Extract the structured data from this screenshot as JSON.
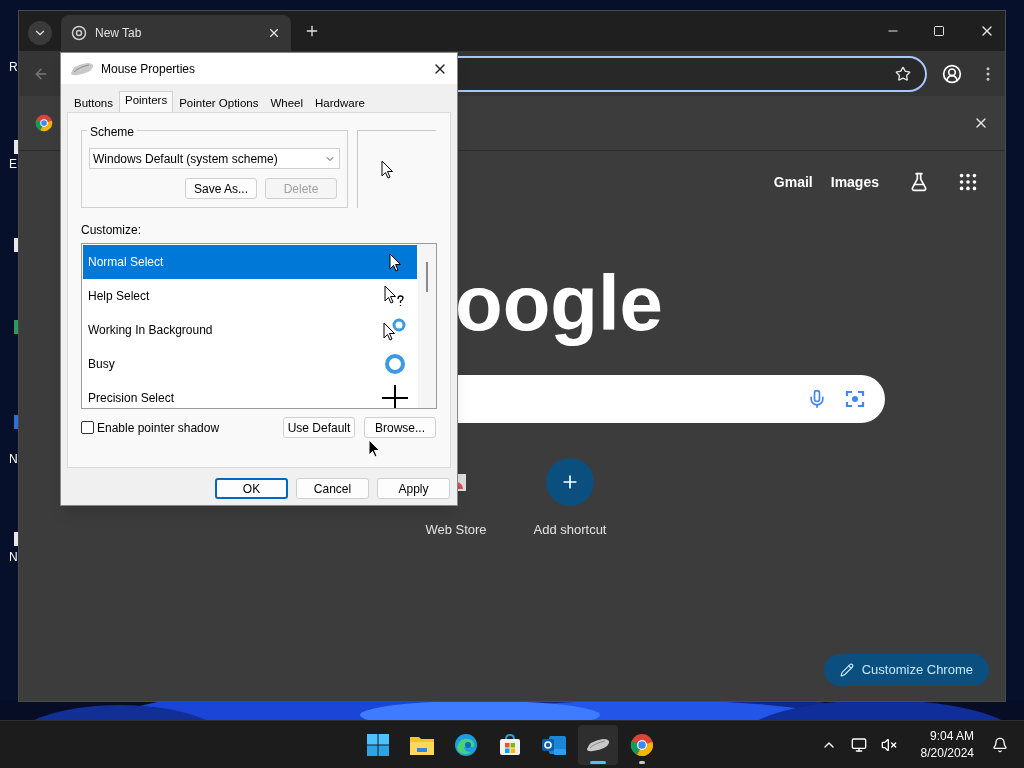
{
  "desktop": {
    "icon_labels": [
      "R",
      "E",
      "N",
      "N"
    ]
  },
  "browser": {
    "tab": {
      "title": "New Tab",
      "selected": true
    },
    "top_links": [
      "Gmail",
      "Images"
    ],
    "logo": "oogle",
    "shortcuts": [
      {
        "label": "Web Store",
        "kind": "store"
      },
      {
        "label": "Add shortcut",
        "kind": "add"
      }
    ],
    "customize_button": "Customize Chrome"
  },
  "dialog": {
    "title": "Mouse Properties",
    "tabs": [
      {
        "label": "Buttons",
        "selected": false
      },
      {
        "label": "Pointers",
        "selected": true
      },
      {
        "label": "Pointer Options",
        "selected": false
      },
      {
        "label": "Wheel",
        "selected": false
      },
      {
        "label": "Hardware",
        "selected": false
      }
    ],
    "scheme": {
      "label": "Scheme",
      "value": "Windows Default (system scheme)",
      "buttons": [
        {
          "label": "Save As...",
          "disabled": false
        },
        {
          "label": "Delete",
          "disabled": true
        }
      ]
    },
    "customize_label": "Customize:",
    "cursors": [
      {
        "name": "Normal Select",
        "kind": "arrow",
        "selected": true
      },
      {
        "name": "Help Select",
        "kind": "help",
        "selected": false
      },
      {
        "name": "Working In Background",
        "kind": "working",
        "selected": false
      },
      {
        "name": "Busy",
        "kind": "busy",
        "selected": false
      },
      {
        "name": "Precision Select",
        "kind": "precision",
        "selected": false
      }
    ],
    "shadow": {
      "label": "Enable pointer shadow",
      "checked": false
    },
    "list_buttons": [
      "Use Default",
      "Browse..."
    ],
    "footer_buttons": [
      {
        "label": "OK",
        "default": true
      },
      {
        "label": "Cancel",
        "default": false
      },
      {
        "label": "Apply",
        "default": false
      }
    ]
  },
  "taskbar": {
    "apps": [
      {
        "kind": "start",
        "active": false,
        "running": false
      },
      {
        "kind": "folder",
        "active": false,
        "running": false
      },
      {
        "kind": "edge",
        "active": false,
        "running": false
      },
      {
        "kind": "store",
        "active": false,
        "running": false
      },
      {
        "kind": "outlook",
        "active": false,
        "running": false
      },
      {
        "kind": "mouse",
        "active": true,
        "running": true
      },
      {
        "kind": "chrome",
        "active": false,
        "running": true
      }
    ],
    "time": "9:04 AM",
    "date": "8/20/2024"
  }
}
